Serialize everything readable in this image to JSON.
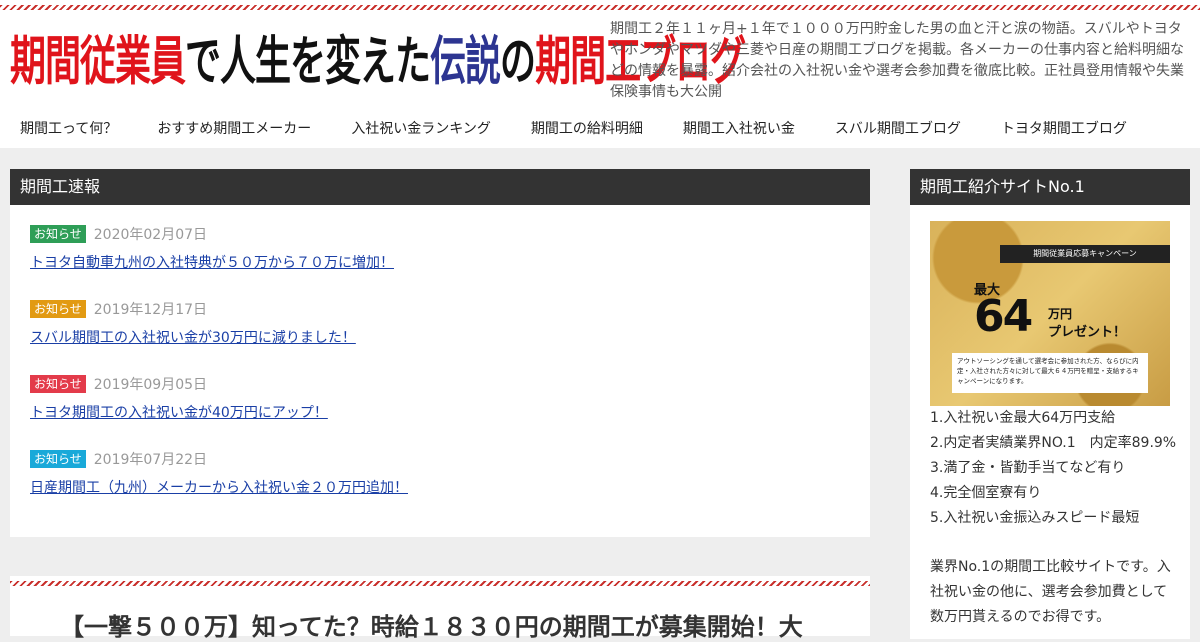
{
  "header": {
    "logo": {
      "part1": "期間従業員",
      "part2": "で人生を変えた",
      "part3": "伝説",
      "part4": "の",
      "part5": "期間工ブログ"
    },
    "tagline": "期間工２年１１ヶ月+１年で１０００万円貯金した男の血と汗と涙の物語。スバルやトヨタやホンダやマツダや三菱や日産の期間工ブログを掲載。各メーカーの仕事内容と給料明細などの情報を暴露。紹介会社の入社祝い金や選考会参加費を徹底比較。正社員登用情報や失業保険事情も大公開"
  },
  "nav": {
    "items": [
      {
        "label": "期間工って何？"
      },
      {
        "label": "おすすめ期間工メーカー"
      },
      {
        "label": "入社祝い金ランキング"
      },
      {
        "label": "期間工の給料明細"
      },
      {
        "label": "期間工入社祝い金"
      },
      {
        "label": "スバル期間工ブログ"
      },
      {
        "label": "トヨタ期間工ブログ"
      }
    ]
  },
  "news": {
    "title": "期間工速報",
    "items": [
      {
        "badge": "お知らせ",
        "badge_color": "#2e9e57",
        "date": "2020年02月07日",
        "title": "トヨタ自動車九州の入社特典が５０万から７０万に増加！"
      },
      {
        "badge": "お知らせ",
        "badge_color": "#e29a12",
        "date": "2019年12月17日",
        "title": "スバル期間工の入社祝い金が30万円に減りました！"
      },
      {
        "badge": "お知らせ",
        "badge_color": "#e33b4a",
        "date": "2019年09月05日",
        "title": "トヨタ期間工の入社祝い金が40万円にアップ！"
      },
      {
        "badge": "お知らせ",
        "badge_color": "#19a9d9",
        "date": "2019年07月22日",
        "title": "日産期間工（九州）メーカーから入社祝い金２０万円追加！"
      }
    ]
  },
  "article": {
    "title": "【一撃５００万】知ってた？時給１８３０円の期間工が募集開始！大"
  },
  "sidebar": {
    "title": "期間工紹介サイトNo.1",
    "banner": {
      "top": "期間従業員応募キャンペーン",
      "max": "最大",
      "amount": "64",
      "unit": "万円",
      "present": "プレゼント！",
      "desc": "アウトソーシングを通して選考会に参加された方、ならびに内定・入社された方々に対して最大６４万円を贈呈・支給するキャンペーンになります。"
    },
    "features": [
      "1.入社祝い金最大64万円支給",
      "2.内定者実績業界NO.1　内定率89.9%",
      "3.満了金・皆勤手当てなど有り",
      "4.完全個室寮有り",
      "5.入社祝い金振込みスピード最短"
    ],
    "description": "業界No.1の期間工比較サイトです。入社祝い金の他に、選考会参加費として数万円貰えるのでお得です。"
  }
}
